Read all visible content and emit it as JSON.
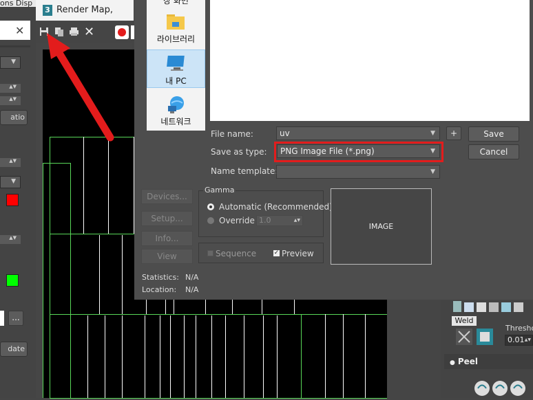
{
  "top_menu": {
    "items_text": "ons  Disp"
  },
  "render_window": {
    "title": "Render Map, Display",
    "app_icon_glyph": "3",
    "toolbar_icons": [
      "save-icon",
      "copy-icon",
      "print-icon",
      "clear-icon",
      "record-icon"
    ]
  },
  "left_panel": {
    "button_top": "atio",
    "button_bottom": "date",
    "ellipsis": "...",
    "swatches": [
      "#ff0000",
      "#00ff00"
    ]
  },
  "dialog": {
    "nav": [
      {
        "label": "장 화면",
        "icon": "desktop-icon"
      },
      {
        "label": "라이브러리",
        "icon": "library-folder-icon"
      },
      {
        "label": "내 PC",
        "icon": "this-pc-icon"
      },
      {
        "label": "네트워크",
        "icon": "network-icon"
      }
    ],
    "file_name_label": "File name:",
    "file_name_value": "uv",
    "save_as_type_label": "Save as type:",
    "save_as_type_value": "PNG Image File (*.png)",
    "name_template_label": "Name template:",
    "name_template_value": "",
    "plus_label": "+",
    "save_label": "Save",
    "cancel_label": "Cancel",
    "side_buttons": [
      "Devices...",
      "Setup...",
      "Info...",
      "View"
    ],
    "gamma_label": "Gamma",
    "gamma_automatic": "Automatic (Recommended)",
    "gamma_override": "Override",
    "gamma_override_value": "1.0",
    "sequence_label": "Sequence",
    "preview_label": "Preview",
    "preview_checked": true,
    "image_label": "IMAGE",
    "statistics_label": "Statistics:",
    "statistics_value": "N/A",
    "location_label": "Location:",
    "location_value": "N/A"
  },
  "command_panel": {
    "weld_label": "Weld",
    "threshold_label": "Threshol",
    "threshold_value": "0.01",
    "peel_label": "Peel"
  },
  "annotation": {
    "arrow_color": "#e31c1c",
    "highlight_color": "#e31c1c"
  }
}
